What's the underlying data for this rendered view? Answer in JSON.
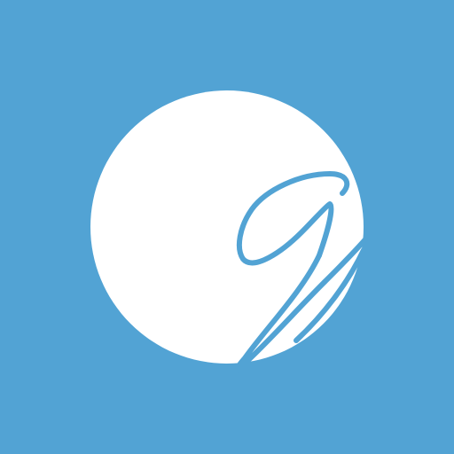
{
  "icon": {
    "name": "script-g-logo-icon",
    "colors": {
      "background": "#52a3d4",
      "circle": "#ffffff",
      "glyph_stroke": "#52a3d4"
    }
  }
}
